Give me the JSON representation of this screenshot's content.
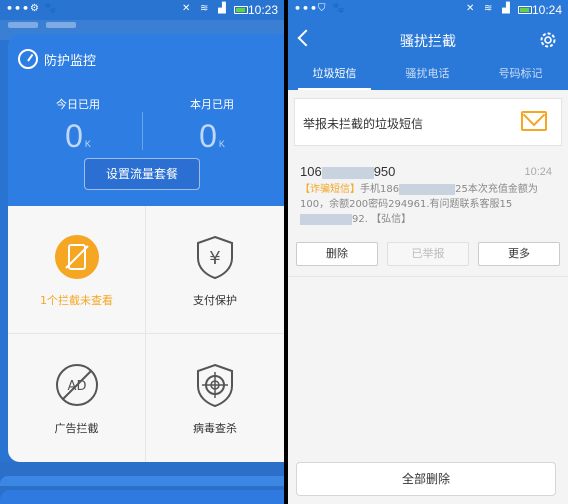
{
  "left": {
    "statusbar": {
      "time": "10:23"
    },
    "card": {
      "title": "防护监控",
      "today_label": "今日已用",
      "today_value": "0",
      "month_label": "本月已用",
      "month_value": "0",
      "unit": "K",
      "set_plan_button": "设置流量套餐"
    },
    "grid": [
      {
        "label": "1个拦截未查看",
        "icon": "blocked-phone-icon"
      },
      {
        "label": "支付保护",
        "icon": "yen-shield-icon"
      },
      {
        "label": "广告拦截",
        "icon": "ad-block-icon"
      },
      {
        "label": "病毒查杀",
        "icon": "virus-scan-icon"
      }
    ],
    "colors": {
      "primary": "#2d7de3",
      "warning": "#f5a623"
    }
  },
  "right": {
    "statusbar": {
      "time": "10:24"
    },
    "header": {
      "title": "骚扰拦截"
    },
    "tabs": [
      {
        "label": "垃圾短信",
        "active": true
      },
      {
        "label": "骚扰电话",
        "active": false
      },
      {
        "label": "号码标记",
        "active": false
      }
    ],
    "report_bar": {
      "text": "举报未拦截的垃圾短信"
    },
    "message": {
      "sender_prefix": "106",
      "sender_suffix": "950",
      "time": "10:24",
      "tag": "【诈骗短信】",
      "body_part1": "手机186",
      "body_part2": "25本次充值金额为100，余额200密码294961.有问题联系客服15",
      "body_part3": "92. 【弘信】"
    },
    "actions": {
      "delete": "删除",
      "reported": "已举报",
      "more": "更多"
    },
    "delete_all": "全部删除"
  }
}
